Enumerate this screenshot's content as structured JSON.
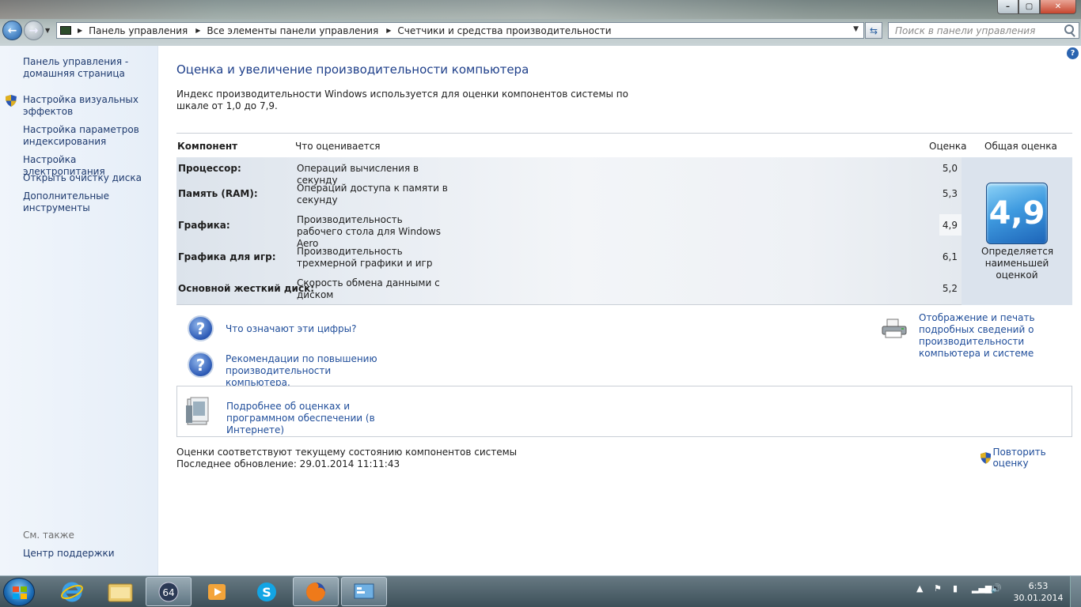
{
  "breadcrumbs": [
    "Панель управления",
    "Все элементы панели управления",
    "Счетчики и средства производительности"
  ],
  "search_placeholder": "Поиск в панели управления",
  "sidebar": {
    "home": "Панель управления - домашняя страница",
    "items": [
      "Настройка визуальных эффектов",
      "Настройка параметров индексирования",
      "Настройка электропитания",
      "Открыть очистку диска",
      "Дополнительные инструменты"
    ],
    "see_also": "См. также",
    "support": "Центр поддержки"
  },
  "main": {
    "title": "Оценка и увеличение производительности компьютера",
    "intro": "Индекс производительности Windows используется для оценки компонентов системы по шкале от 1,0 до 7,9.",
    "headers": {
      "component": "Компонент",
      "what": "Что оценивается",
      "score": "Оценка",
      "total": "Общая оценка"
    },
    "rows": [
      {
        "component": "Процессор:",
        "what": "Операций вычисления в секунду",
        "score": "5,0"
      },
      {
        "component": "Память (RAM):",
        "what": "Операций доступа к памяти в секунду",
        "score": "5,3"
      },
      {
        "component": "Графика:",
        "what": "Производительность рабочего стола для Windows Aero",
        "score": "4,9"
      },
      {
        "component": "Графика для игр:",
        "what": "Производительность трехмерной графики и игр",
        "score": "6,1"
      },
      {
        "component": "Основной жесткий диск:",
        "what": "Скорость обмена данными с диском",
        "score": "5,2"
      }
    ],
    "total_score": "4,9",
    "total_caption": "Определяется наименьшей оценкой",
    "links": {
      "what_numbers": "Что означают эти цифры?",
      "recommendations": "Рекомендации по повышению производительности компьютера.",
      "print_details": "Отображение и печать подробных сведений о производительности компьютера и системе",
      "more_info": "Подробнее об оценках и программном обеспечении (в Интернете)"
    },
    "status_line1": "Оценки соответствуют текущему состоянию компонентов системы",
    "status_line2": "Последнее обновление: 29.01.2014 11:11:43",
    "rerun": "Повторить оценку"
  },
  "taskbar": {
    "time": "6:53",
    "date": "30.01.2014"
  },
  "colors": {
    "accent": "#1e3f8a",
    "link": "#1f4d9a",
    "badge": "#3f9be0"
  }
}
